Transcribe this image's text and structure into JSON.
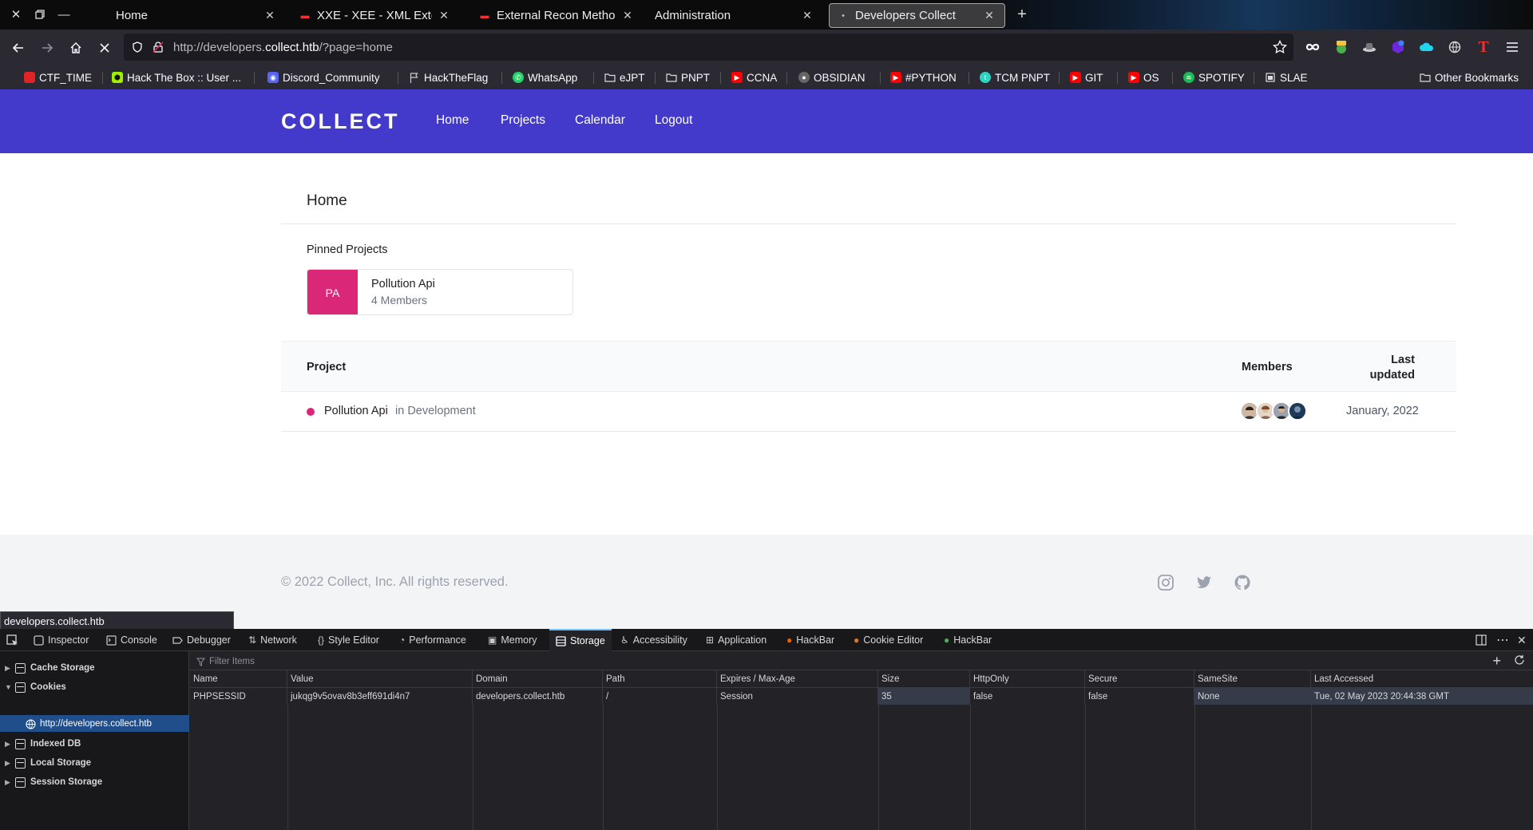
{
  "browser": {
    "tabs": [
      {
        "label": "Home",
        "active": false
      },
      {
        "label": "XXE - XEE - XML External En",
        "active": false
      },
      {
        "label": "External Recon Methodolo",
        "active": false
      },
      {
        "label": "Administration",
        "active": false
      },
      {
        "label": "Developers Collect",
        "active": true
      }
    ],
    "url_prefix": "http://developers.",
    "url_domain": "collect.htb",
    "url_path": "/?page=home",
    "bookmarks": [
      {
        "label": "CTF_TIME",
        "color": "#e02424"
      },
      {
        "label": "Hack The Box :: User ...",
        "color": "#9fef00"
      },
      {
        "label": "Discord_Community",
        "color": "#5865f2"
      },
      {
        "label": "HackTheFlag",
        "color": "#888888"
      },
      {
        "label": "WhatsApp",
        "color": "#25d366"
      },
      {
        "label": "eJPT",
        "color": "#888888"
      },
      {
        "label": "PNPT",
        "color": "#888888"
      },
      {
        "label": "CCNA",
        "color": "#ff0000"
      },
      {
        "label": "OBSIDIAN",
        "color": "#aaaaaa"
      },
      {
        "label": "#PYTHON",
        "color": "#ff0000"
      },
      {
        "label": "TCM PNPT",
        "color": "#2dd4bf"
      },
      {
        "label": "GIT",
        "color": "#ff0000"
      },
      {
        "label": "OS",
        "color": "#ff0000"
      },
      {
        "label": "SPOTIFY",
        "color": "#1db954"
      },
      {
        "label": "SLAE",
        "color": "#888888"
      }
    ],
    "other_bookmarks": "Other Bookmarks",
    "status_url": "developers.collect.htb"
  },
  "site": {
    "brand": "COLLECT",
    "nav": [
      "Home",
      "Projects",
      "Calendar",
      "Logout"
    ],
    "page_title": "Home",
    "pinned_label": "Pinned Projects",
    "pinned": {
      "initials": "PA",
      "name": "Pollution Api",
      "members": "4 Members"
    },
    "table": {
      "headers": {
        "project": "Project",
        "members": "Members",
        "last_updated_1": "Last",
        "last_updated_2": "updated"
      },
      "rows": [
        {
          "name": "Pollution Api",
          "state": "in Development",
          "date": "January, 2022"
        }
      ]
    },
    "footer": "© 2022 Collect, Inc. All rights reserved.",
    "accent": "#4339ca",
    "pink": "#db2777"
  },
  "devtools": {
    "tools": [
      {
        "label": "Inspector",
        "icon": "inspector-icon"
      },
      {
        "label": "Console",
        "icon": "console-icon"
      },
      {
        "label": "Debugger",
        "icon": "debugger-icon"
      },
      {
        "label": "Network",
        "icon": "network-icon"
      },
      {
        "label": "Style Editor",
        "icon": "style-editor-icon"
      },
      {
        "label": "Performance",
        "icon": "performance-icon"
      },
      {
        "label": "Memory",
        "icon": "memory-icon"
      },
      {
        "label": "Storage",
        "icon": "storage-icon"
      },
      {
        "label": "Accessibility",
        "icon": "accessibility-icon"
      },
      {
        "label": "Application",
        "icon": "application-icon"
      },
      {
        "label": "HackBar",
        "icon": "hackbar-icon"
      },
      {
        "label": "Cookie Editor",
        "icon": "cookie-icon"
      },
      {
        "label": "HackBar",
        "icon": "hackbar-icon"
      }
    ],
    "selected_tool": "Storage",
    "sidebar": [
      "Cache Storage",
      "Cookies",
      "Indexed DB",
      "Local Storage",
      "Session Storage"
    ],
    "cookie_host": "http://developers.collect.htb",
    "filter_placeholder": "Filter Items",
    "columns": [
      "Name",
      "Value",
      "Domain",
      "Path",
      "Expires / Max-Age",
      "Size",
      "HttpOnly",
      "Secure",
      "SameSite",
      "Last Accessed"
    ],
    "cookie": [
      "PHPSESSID",
      "jukqg9v5ovav8b3eff691di4n7",
      "developers.collect.htb",
      "/",
      "Session",
      "35",
      "false",
      "false",
      "None",
      "Tue, 02 May 2023 20:44:38 GMT"
    ]
  }
}
